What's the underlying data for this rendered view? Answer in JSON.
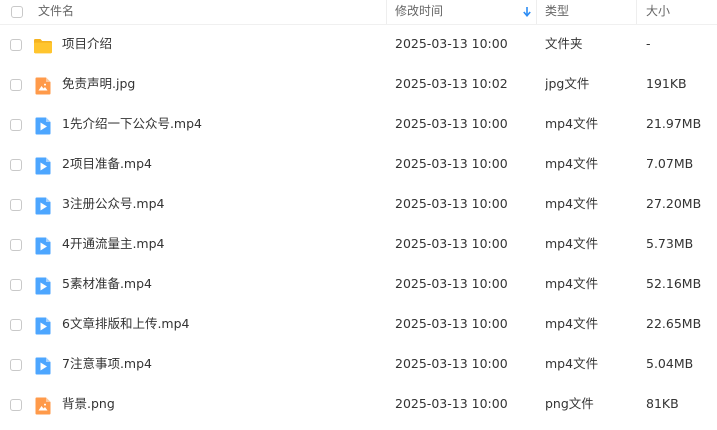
{
  "header": {
    "name_label": "文件名",
    "time_label": "修改时间",
    "type_label": "类型",
    "size_label": "大小"
  },
  "colors": {
    "folder": "#FFC52E",
    "image_file": "#FF9A4A",
    "video_file": "#4DA6FF",
    "sort_arrow": "#2C8CF4"
  },
  "files": [
    {
      "icon": "folder-icon",
      "name": "项目介绍",
      "modified": "2025-03-13 10:00",
      "type": "文件夹",
      "size": "-"
    },
    {
      "icon": "image-file-icon",
      "name": "免责声明.jpg",
      "modified": "2025-03-13 10:02",
      "type": "jpg文件",
      "size": "191KB"
    },
    {
      "icon": "video-file-icon",
      "name": "1先介绍一下公众号.mp4",
      "modified": "2025-03-13 10:00",
      "type": "mp4文件",
      "size": "21.97MB"
    },
    {
      "icon": "video-file-icon",
      "name": "2项目准备.mp4",
      "modified": "2025-03-13 10:00",
      "type": "mp4文件",
      "size": "7.07MB"
    },
    {
      "icon": "video-file-icon",
      "name": "3注册公众号.mp4",
      "modified": "2025-03-13 10:00",
      "type": "mp4文件",
      "size": "27.20MB"
    },
    {
      "icon": "video-file-icon",
      "name": "4开通流量主.mp4",
      "modified": "2025-03-13 10:00",
      "type": "mp4文件",
      "size": "5.73MB"
    },
    {
      "icon": "video-file-icon",
      "name": "5素材准备.mp4",
      "modified": "2025-03-13 10:00",
      "type": "mp4文件",
      "size": "52.16MB"
    },
    {
      "icon": "video-file-icon",
      "name": "6文章排版和上传.mp4",
      "modified": "2025-03-13 10:00",
      "type": "mp4文件",
      "size": "22.65MB"
    },
    {
      "icon": "video-file-icon",
      "name": "7注意事项.mp4",
      "modified": "2025-03-13 10:00",
      "type": "mp4文件",
      "size": "5.04MB"
    },
    {
      "icon": "image-file-icon",
      "name": "背景.png",
      "modified": "2025-03-13 10:00",
      "type": "png文件",
      "size": "81KB"
    }
  ]
}
